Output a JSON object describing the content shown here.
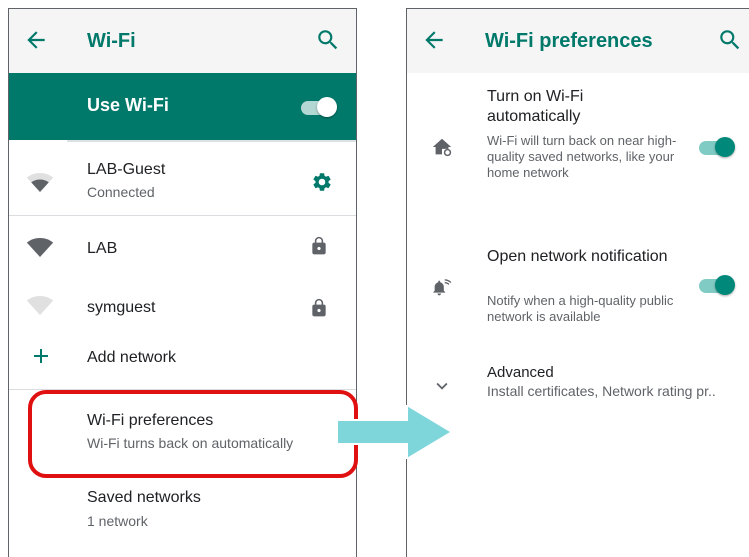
{
  "left_screen": {
    "title": "Wi-Fi",
    "use_wifi": {
      "label": "Use Wi-Fi",
      "enabled": true
    },
    "connected_network": {
      "name": "LAB-Guest",
      "status": "Connected"
    },
    "networks": [
      {
        "name": "LAB",
        "locked": true
      },
      {
        "name": "symguest",
        "locked": true
      }
    ],
    "add_network_label": "Add network",
    "preferences": {
      "title": "Wi-Fi preferences",
      "subtitle": "Wi-Fi turns back on automatically"
    },
    "saved_networks": {
      "title": "Saved networks",
      "subtitle": "1 network"
    }
  },
  "right_screen": {
    "title": "Wi-Fi preferences",
    "items": [
      {
        "title": "Turn on Wi-Fi automatically",
        "subtitle": "Wi-Fi will turn back on near high-quality saved networks, like your home network",
        "enabled": true
      },
      {
        "title": "Open network notification",
        "subtitle": "Notify when a high-quality public network is available",
        "enabled": true
      }
    ],
    "advanced": {
      "title": "Advanced",
      "subtitle": "Install certificates, Network rating pr.."
    }
  },
  "icons": [
    "back-arrow-icon",
    "search-icon",
    "wifi-signal-icon",
    "settings-gear-icon",
    "lock-icon",
    "plus-icon",
    "wifi-auto-icon",
    "wifi-notification-icon",
    "chevron-down-icon"
  ],
  "colors": {
    "accent": "#00796b",
    "highlight": "#e01010",
    "arrow": "#7fd6da"
  }
}
